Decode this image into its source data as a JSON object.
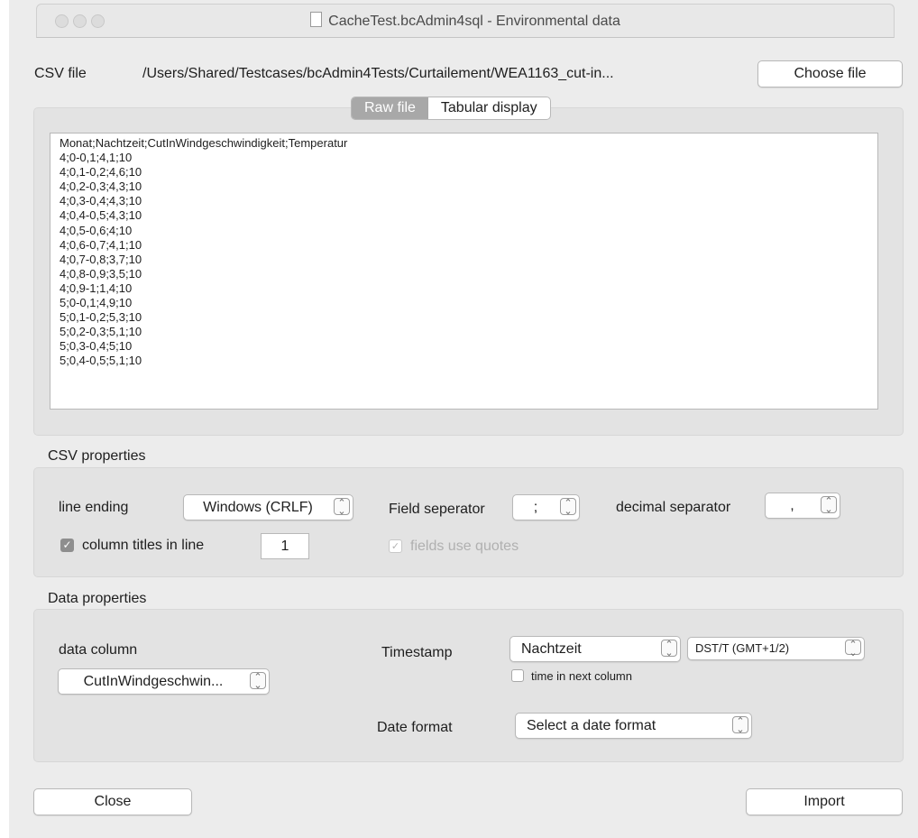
{
  "window": {
    "title": "CacheTest.bcAdmin4sql - Environmental data"
  },
  "csv_file": {
    "label": "CSV file",
    "path": "/Users/Shared/Testcases/bcAdmin4Tests/Curtailement/WEA1163_cut-in...",
    "choose_button": "Choose file"
  },
  "tabs": {
    "raw": "Raw file",
    "tabular": "Tabular display",
    "active": "raw"
  },
  "raw_file": {
    "lines": [
      "Monat;Nachtzeit;CutInWindgeschwindigkeit;Temperatur",
      "4;0-0,1;4,1;10",
      "4;0,1-0,2;4,6;10",
      "4;0,2-0,3;4,3;10",
      "4;0,3-0,4;4,3;10",
      "4;0,4-0,5;4,3;10",
      "4;0,5-0,6;4;10",
      "4;0,6-0,7;4,1;10",
      "4;0,7-0,8;3,7;10",
      "4;0,8-0,9;3,5;10",
      "4;0,9-1;1,4;10",
      "5;0-0,1;4,9;10",
      "5;0,1-0,2;5,3;10",
      "5;0,2-0,3;5,1;10",
      "5;0,3-0,4;5;10",
      "5;0,4-0,5;5,1;10"
    ]
  },
  "csv_properties": {
    "heading": "CSV properties",
    "line_ending_label": "line ending",
    "line_ending_value": "Windows (CRLF)",
    "field_separator_label": "Field seperator",
    "field_separator_value": ";",
    "decimal_separator_label": "decimal separator",
    "decimal_separator_value": ",",
    "column_titles_label": "column titles in line",
    "column_titles_checked": true,
    "column_titles_line": "1",
    "fields_use_quotes_label": "fields use quotes",
    "fields_use_quotes_checked": true,
    "fields_use_quotes_enabled": false
  },
  "data_properties": {
    "heading": "Data properties",
    "data_column_label": "data column",
    "data_column_value": "CutInWindgeschwin...",
    "timestamp_label": "Timestamp",
    "timestamp_value": "Nachtzeit",
    "timezone_value": "DST/T (GMT+1/2)",
    "time_next_column_label": "time in next column",
    "time_next_column_checked": false,
    "date_format_label": "Date format",
    "date_format_value": "Select a date format"
  },
  "buttons": {
    "close": "Close",
    "import": "Import"
  },
  "icons": {
    "checkmark": "✓",
    "popup_arrows": "⌃⌄"
  }
}
